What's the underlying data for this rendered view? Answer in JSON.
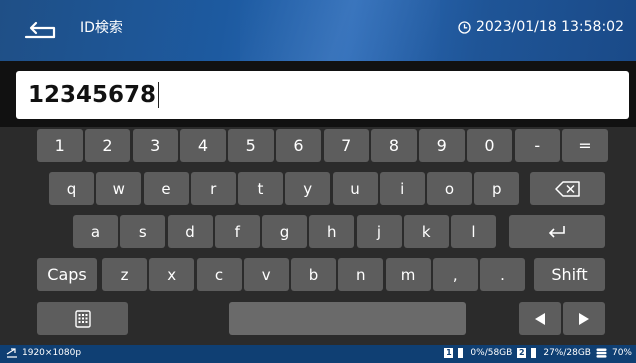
{
  "header": {
    "title": "ID検索",
    "datetime": "2023/01/18 13:58:02",
    "back_icon": "back-return-icon",
    "clock_icon": "clock-icon"
  },
  "input": {
    "value": "12345678"
  },
  "keyboard": {
    "row1": [
      "1",
      "2",
      "3",
      "4",
      "5",
      "6",
      "7",
      "8",
      "9",
      "0",
      "-",
      "="
    ],
    "row2": [
      "q",
      "w",
      "e",
      "r",
      "t",
      "y",
      "u",
      "i",
      "o",
      "p"
    ],
    "row3": [
      "a",
      "s",
      "d",
      "f",
      "g",
      "h",
      "j",
      "k",
      "l"
    ],
    "row4": [
      "z",
      "x",
      "c",
      "v",
      "b",
      "n",
      "m",
      ",",
      "."
    ],
    "caps_label": "Caps",
    "shift_label": "Shift",
    "backspace_icon": "backspace-icon",
    "enter_icon": "enter-icon",
    "keyboard_toggle_icon": "keyboard-icon",
    "left_arrow_icon": "arrow-left-icon",
    "right_arrow_icon": "arrow-right-icon"
  },
  "status": {
    "resolution": "1920×1080p",
    "disk1_label": "1",
    "disk1_usage": "0%/58GB",
    "disk2_label": "2",
    "disk2_usage": "27%/28GB",
    "storage_usage": "70%"
  },
  "colors": {
    "header_bg": "#1d5aa0",
    "key_bg": "#5d5d5d",
    "keyboard_bg": "#2b2b2b",
    "status_bg": "#0f3f73"
  }
}
